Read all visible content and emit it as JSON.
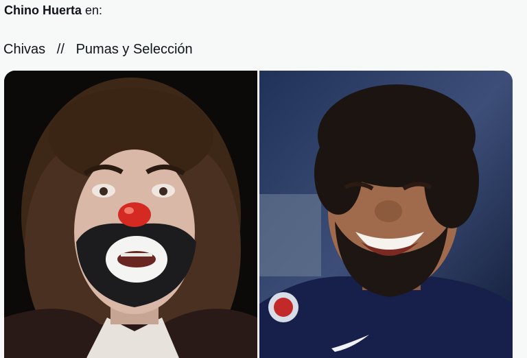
{
  "post": {
    "author_name": "Chino Huerta",
    "author_suffix": " en:",
    "text": "Chivas   //   Pumas y Selección"
  },
  "media": {
    "left_image": "clown-face-photo",
    "right_image": "smiling-footballer-photo"
  },
  "colors": {
    "text": "#0f1419",
    "background": "#f7f9f9"
  }
}
